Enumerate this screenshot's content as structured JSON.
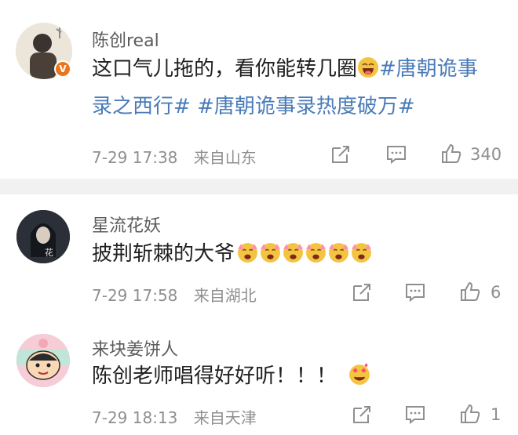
{
  "post": {
    "author": "陈创real",
    "text_plain": "这口气儿拖的，看你能转几圈",
    "hashtag1_line1": "#唐朝诡事",
    "hashtag1_line2": "录之西行#",
    "hashtag2": "#唐朝诡事录热度破万#",
    "date": "7-29",
    "time": "17:38",
    "location": "来自山东",
    "likes": "340",
    "verified_badge": "V"
  },
  "comments": [
    {
      "author": "星流花妖",
      "text": "披荆斩棘的大爷",
      "emoji_count": 6,
      "date": "7-29",
      "time": "17:58",
      "location": "来自湖北",
      "likes": "6"
    },
    {
      "author": "来块姜饼人",
      "text": "陈创老师唱得好好听！！！",
      "date": "7-29",
      "time": "18:13",
      "location": "来自天津",
      "likes": "1"
    }
  ],
  "icons": [
    "share-icon",
    "comment-icon",
    "like-icon",
    "laugh-emoji-icon",
    "cheer-emoji-icon",
    "love-emoji-icon"
  ],
  "colors": {
    "hashtag": "#4a7bb8",
    "meta": "#8f8f8f",
    "separator": "#f1f1f1",
    "badge": "#e9751f"
  }
}
